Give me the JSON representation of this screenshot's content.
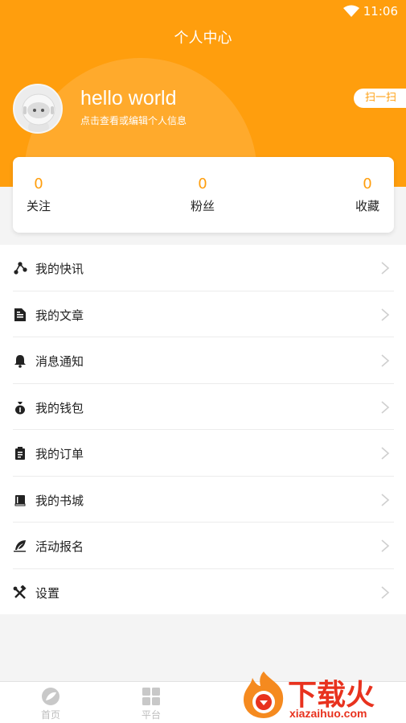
{
  "status_bar": {
    "time": "11:06"
  },
  "header": {
    "title": "个人中心",
    "accent": "#ff9e0d"
  },
  "profile": {
    "username": "hello world",
    "hint": "点击查看或编辑个人信息",
    "scan_label": "扫一扫"
  },
  "stats": [
    {
      "value": "0",
      "label": "关注"
    },
    {
      "value": "0",
      "label": "粉丝"
    },
    {
      "value": "0",
      "label": "收藏"
    }
  ],
  "menu": {
    "items": [
      {
        "label": "我的快讯",
        "icon": "share-nodes-icon"
      },
      {
        "label": "我的文章",
        "icon": "article-icon"
      },
      {
        "label": "消息通知",
        "icon": "bell-icon"
      },
      {
        "label": "我的钱包",
        "icon": "money-bag-icon"
      },
      {
        "label": "我的订单",
        "icon": "clipboard-icon"
      },
      {
        "label": "我的书城",
        "icon": "book-icon"
      },
      {
        "label": "活动报名",
        "icon": "feather-icon"
      },
      {
        "label": "设置",
        "icon": "tools-icon"
      }
    ]
  },
  "tabbar": {
    "tabs": [
      {
        "label": "首页",
        "icon": "home-leaf-icon"
      },
      {
        "label": "平台",
        "icon": "grid-icon"
      }
    ]
  },
  "watermark": {
    "title": "下载火",
    "domain": "xiazaihuo.com"
  }
}
